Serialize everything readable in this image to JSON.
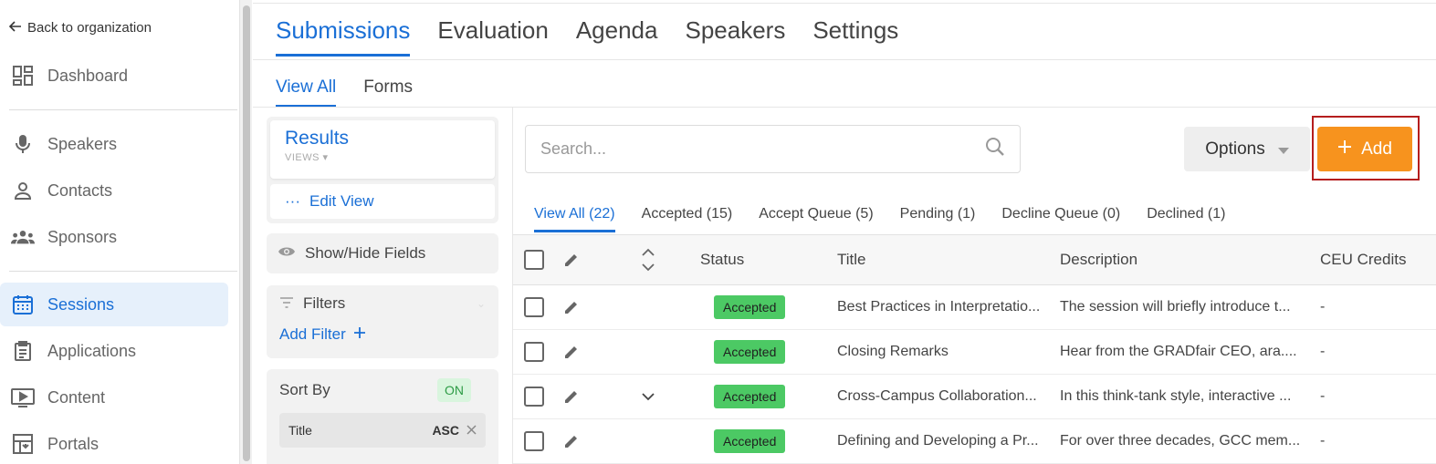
{
  "sidebar": {
    "back_label": "Back to organization",
    "items": [
      {
        "label": "Dashboard",
        "icon": "dashboard-icon"
      },
      {
        "label": "Speakers",
        "icon": "microphone-icon"
      },
      {
        "label": "Contacts",
        "icon": "person-icon"
      },
      {
        "label": "Sponsors",
        "icon": "group-icon"
      },
      {
        "label": "Sessions",
        "icon": "calendar-icon",
        "active": true
      },
      {
        "label": "Applications",
        "icon": "clipboard-icon"
      },
      {
        "label": "Content",
        "icon": "play-screen-icon"
      },
      {
        "label": "Portals",
        "icon": "portal-icon"
      }
    ]
  },
  "main_tabs": [
    "Submissions",
    "Evaluation",
    "Agenda",
    "Speakers",
    "Settings"
  ],
  "sub_tabs": [
    "View All",
    "Forms"
  ],
  "left_panel": {
    "results_title": "Results",
    "views_label": "VIEWS",
    "edit_view_label": "Edit View",
    "show_hide_label": "Show/Hide Fields",
    "filters_label": "Filters",
    "add_filter_label": "Add Filter",
    "sort_by_label": "Sort By",
    "sort_status": "ON",
    "sort_field": "Title",
    "sort_direction": "ASC"
  },
  "toolbar": {
    "search_placeholder": "Search...",
    "options_label": "Options",
    "add_label": "Add"
  },
  "status_tabs": [
    "View All (22)",
    "Accepted (15)",
    "Accept Queue (5)",
    "Pending (1)",
    "Decline Queue (0)",
    "Declined (1)"
  ],
  "table": {
    "headers": {
      "status": "Status",
      "title": "Title",
      "description": "Description",
      "ceu": "CEU Credits"
    },
    "rows": [
      {
        "status": "Accepted",
        "title": "Best Practices in Interpretatio...",
        "description": "The session will briefly introduce t...",
        "ceu": "-",
        "expand": false
      },
      {
        "status": "Accepted",
        "title": "Closing Remarks",
        "description": "Hear from the GRADfair CEO, ara....",
        "ceu": "-",
        "expand": false
      },
      {
        "status": "Accepted",
        "title": "Cross-Campus Collaboration...",
        "description": "In this think-tank style, interactive ...",
        "ceu": "-",
        "expand": true
      },
      {
        "status": "Accepted",
        "title": "Defining and Developing a Pr...",
        "description": "For over three decades, GCC mem...",
        "ceu": "-",
        "expand": false
      }
    ]
  },
  "colors": {
    "accent": "#1a6fd6",
    "add_button": "#f7931e",
    "accepted_badge": "#4cc964",
    "highlight_border": "#b51e1e"
  }
}
